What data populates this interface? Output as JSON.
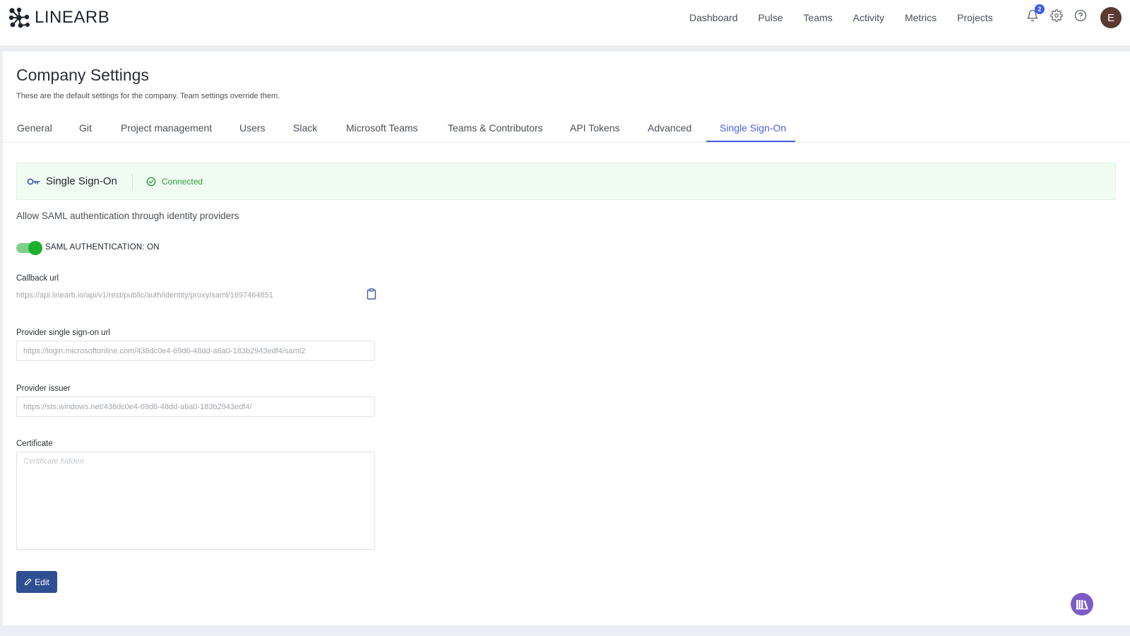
{
  "brand": {
    "name": "LINEARB"
  },
  "nav": {
    "items": [
      "Dashboard",
      "Pulse",
      "Teams",
      "Activity",
      "Metrics",
      "Projects"
    ],
    "notifications_count": "2",
    "avatar_initial": "E"
  },
  "page": {
    "title": "Company Settings",
    "subtitle": "These are the default settings for the company. Team settings override them."
  },
  "tabs": [
    "General",
    "Git",
    "Project management",
    "Users",
    "Slack",
    "Microsoft Teams",
    "Teams & Contributors",
    "API Tokens",
    "Advanced",
    "Single Sign-On"
  ],
  "active_tab": "Single Sign-On",
  "sso": {
    "title": "Single Sign-On",
    "status": "Connected",
    "description": "Allow SAML authentication through identity providers",
    "toggle_label": "SAML AUTHENTICATION: ON",
    "callback_label": "Callback url",
    "callback_value": "https://api.linearb.io/api/v1/rest/public/auth/identity/proxy/saml/1697464851",
    "provider_sso_label": "Provider single sign-on url",
    "provider_sso_value": "https://login.microsoftonline.com/438dc0e4-69d6-48dd-a6a0-183b2943edf4/saml2",
    "provider_issuer_label": "Provider issuer",
    "provider_issuer_value": "https://sts.windows.net/438dc0e4-69d6-48dd-a6a0-183b2943edf4/",
    "certificate_label": "Certificate",
    "certificate_placeholder": "Certificate hidden",
    "edit_label": "Edit"
  },
  "colors": {
    "accent": "#4a5ee8",
    "success": "#2a9a3a",
    "primary_button": "#2f4f93",
    "help_fab": "#7c5cc4"
  }
}
